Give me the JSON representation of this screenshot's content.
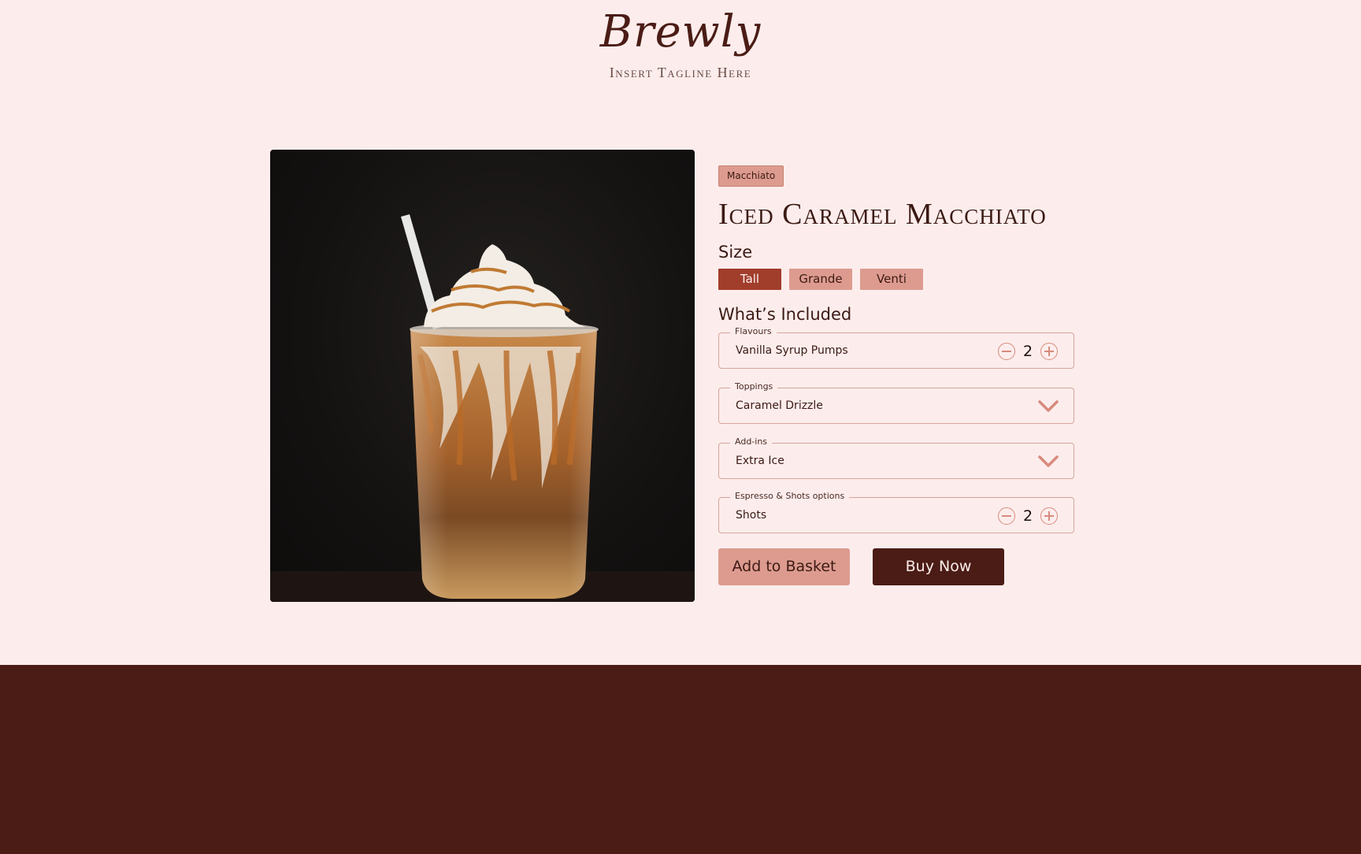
{
  "header": {
    "brand": "Brewly",
    "tagline": "Insert Tagline Here"
  },
  "product": {
    "category_tag": "Macchiato",
    "title": "Iced Caramel Macchiato",
    "image_alt": "Iced caramel macchiato in a tall glass with whipped cream and a straw"
  },
  "size": {
    "label": "Size",
    "options": [
      "Tall",
      "Grande",
      "Venti"
    ],
    "selected": "Tall"
  },
  "included": {
    "label": "What’s Included",
    "flavours": {
      "legend": "Flavours",
      "value": "Vanilla Syrup Pumps",
      "count": "2"
    },
    "toppings": {
      "legend": "Toppings",
      "value": "Caramel Drizzle"
    },
    "addins": {
      "legend": "Add-ins",
      "value": "Extra Ice"
    },
    "espresso": {
      "legend": "Espresso & Shots options",
      "value": "Shots",
      "count": "2"
    }
  },
  "actions": {
    "add_to_basket": "Add to Basket",
    "buy_now": "Buy Now"
  },
  "colors": {
    "background": "#fcedec",
    "accent": "#dd9b8f",
    "accent_active": "#a13d2b",
    "brand_dark": "#4a1c15"
  },
  "icons": {
    "decrement": "minus-circle-icon",
    "increment": "plus-circle-icon",
    "dropdown": "chevron-down-icon"
  }
}
